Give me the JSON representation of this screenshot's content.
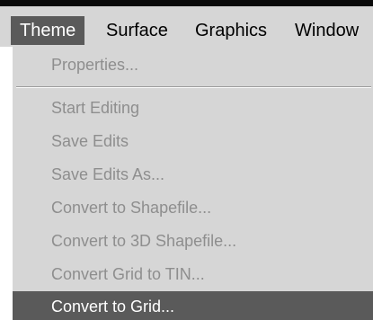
{
  "menubar": {
    "items": [
      {
        "label": "Theme",
        "active": true
      },
      {
        "label": "Surface",
        "active": false
      },
      {
        "label": "Graphics",
        "active": false
      },
      {
        "label": "Window",
        "active": false
      }
    ]
  },
  "theme_menu": {
    "items": [
      {
        "label": "Properties...",
        "enabled": false
      },
      {
        "label": "Start Editing",
        "enabled": false
      },
      {
        "label": "Save Edits",
        "enabled": false
      },
      {
        "label": "Save Edits As...",
        "enabled": false
      },
      {
        "label": "Convert to Shapefile...",
        "enabled": false
      },
      {
        "label": "Convert to 3D Shapefile...",
        "enabled": false
      },
      {
        "label": "Convert Grid to TIN...",
        "enabled": false
      },
      {
        "label": "Convert to Grid...",
        "enabled": true,
        "highlighted": true
      }
    ]
  },
  "colors": {
    "menu_background": "#d6d6d6",
    "highlight": "#5a5a5a",
    "disabled_text": "#8e8e8e",
    "top_bar": "#0a0a0a"
  }
}
